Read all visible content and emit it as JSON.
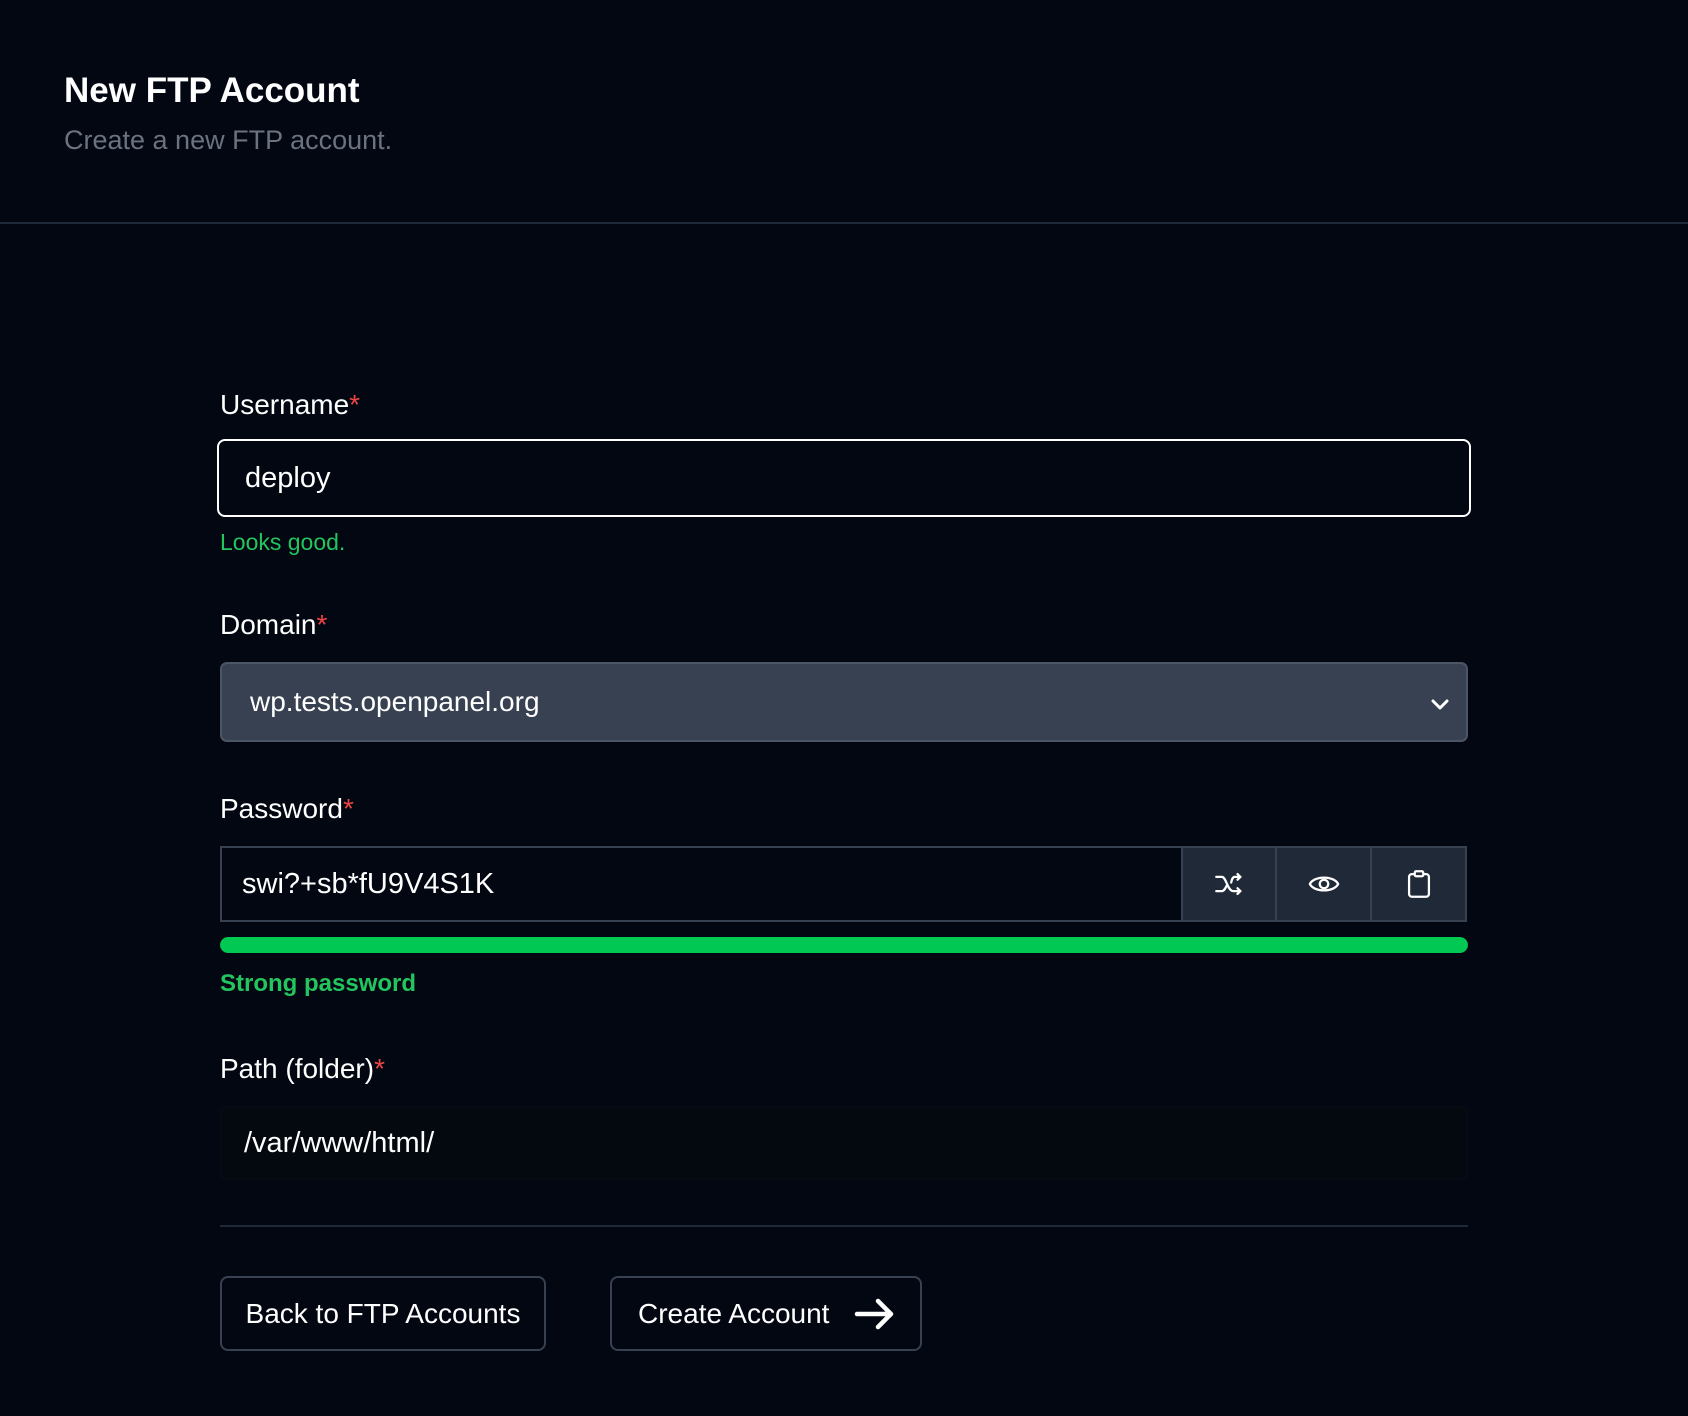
{
  "header": {
    "title": "New FTP Account",
    "subtitle": "Create a new FTP account."
  },
  "form": {
    "username": {
      "label": "Username",
      "required_mark": "*",
      "value": "deploy",
      "feedback": "Looks good."
    },
    "domain": {
      "label": "Domain",
      "required_mark": "*",
      "selected": "wp.tests.openpanel.org",
      "icon": "chevron-down-icon"
    },
    "password": {
      "label": "Password",
      "required_mark": "*",
      "value": "swi?+sb*fU9V4S1K",
      "buttons": [
        "shuffle-icon",
        "eye-icon",
        "clipboard-icon"
      ],
      "strength_level": 1.0,
      "strength_text": "Strong password"
    },
    "path": {
      "label": "Path (folder)",
      "required_mark": "*",
      "value": "/var/www/html/"
    }
  },
  "actions": {
    "back_label": "Back to FTP Accounts",
    "create_label": "Create Account",
    "create_icon": "arrow-right-icon"
  },
  "colors": {
    "background": "#030712",
    "required": "#ef4444",
    "success": "#22c55e",
    "strength_bar": "#00c853",
    "select_bg": "#374151"
  }
}
